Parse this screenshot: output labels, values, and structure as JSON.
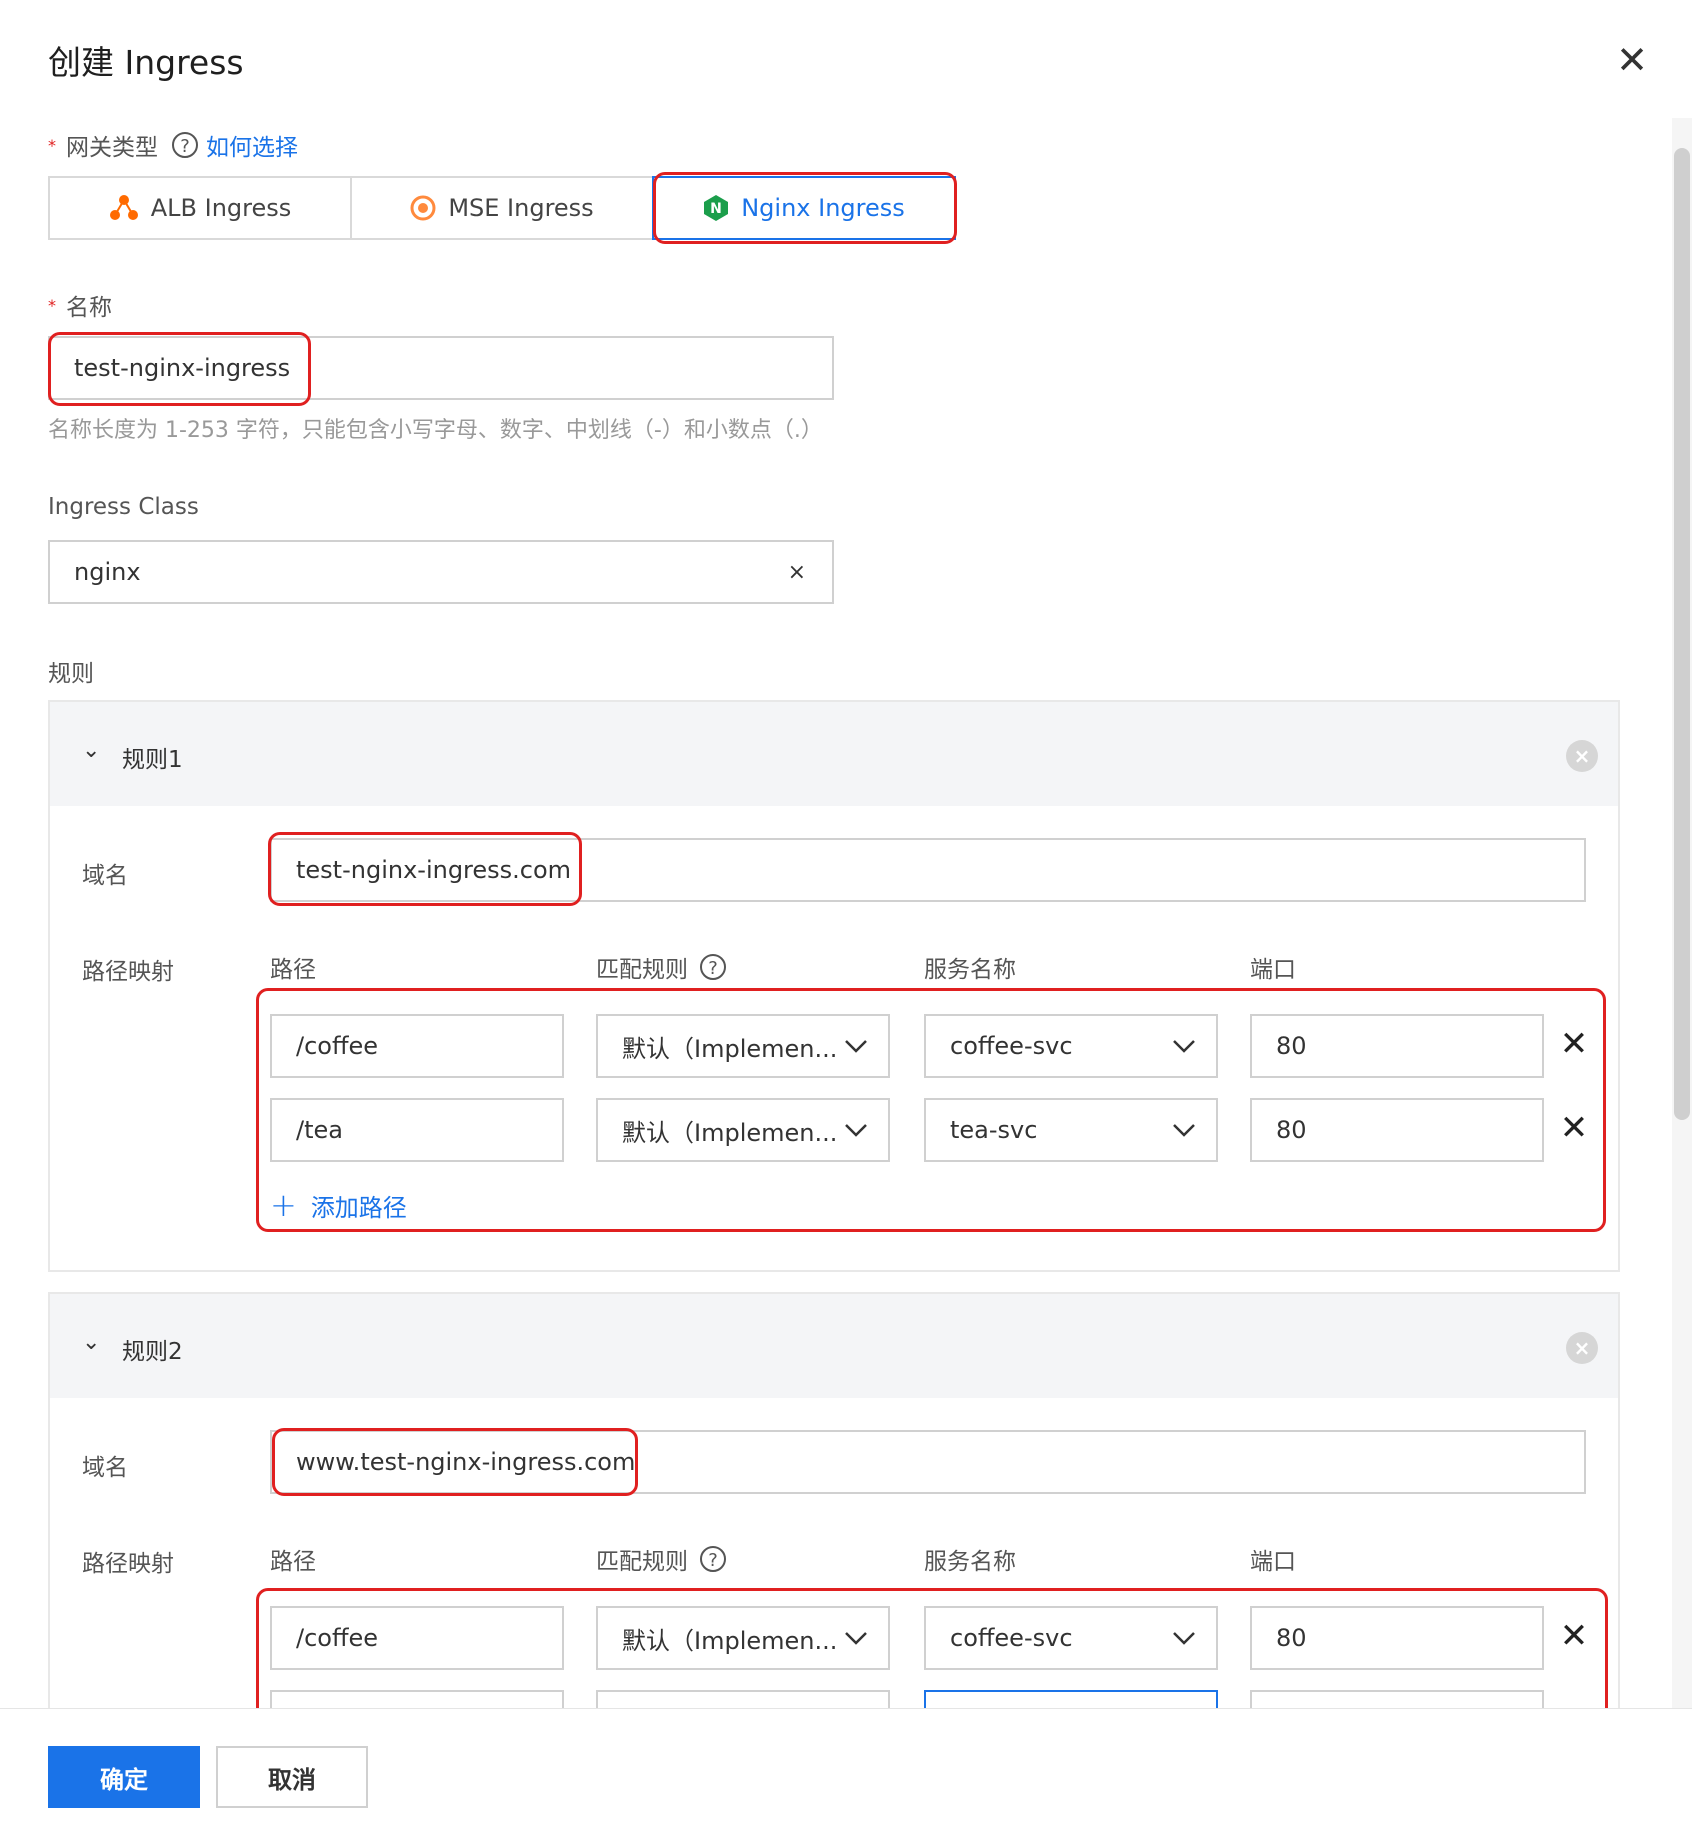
{
  "dialog": {
    "title": "创建 Ingress"
  },
  "gateway": {
    "label": "网关类型",
    "help_link": "如何选择",
    "tabs": [
      {
        "label": "ALB Ingress"
      },
      {
        "label": "MSE Ingress"
      },
      {
        "label": "Nginx Ingress"
      }
    ],
    "selected": "Nginx Ingress"
  },
  "name": {
    "label": "名称",
    "value": "test-nginx-ingress",
    "hint": "名称长度为 1-253 字符，只能包含小写字母、数字、中划线（-）和小数点（.）"
  },
  "ingress_class": {
    "label": "Ingress Class",
    "value": "nginx",
    "clear": "×"
  },
  "rules": {
    "label": "规则",
    "col_headers": {
      "path": "路径",
      "match": "匹配规则",
      "service": "服务名称",
      "port": "端口"
    },
    "domain_label": "域名",
    "path_map_label": "路径映射",
    "add_path": "添加路径",
    "items": [
      {
        "title": "规则1",
        "domain": "test-nginx-ingress.com",
        "paths": [
          {
            "path": "/coffee",
            "match": "默认（Implemen...",
            "service": "coffee-svc",
            "port": "80"
          },
          {
            "path": "/tea",
            "match": "默认（Implemen...",
            "service": "tea-svc",
            "port": "80"
          }
        ]
      },
      {
        "title": "规则2",
        "domain": "www.test-nginx-ingress.com",
        "paths": [
          {
            "path": "/coffee",
            "match": "默认（Implemen...",
            "service": "coffee-svc",
            "port": "80"
          }
        ]
      }
    ]
  },
  "footer": {
    "ok": "确定",
    "cancel": "取消"
  },
  "colors": {
    "accent": "#1a73e8",
    "highlight": "#e02020"
  }
}
